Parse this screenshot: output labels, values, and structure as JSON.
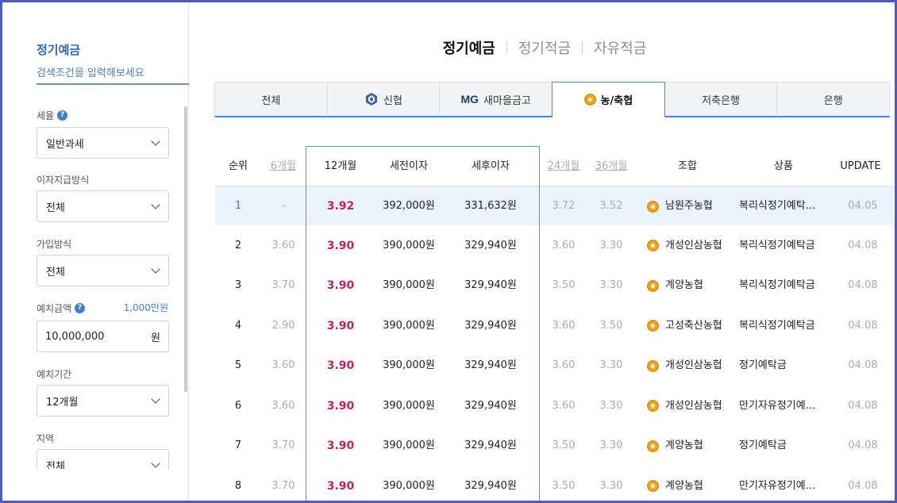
{
  "sidebar": {
    "title": "정기예금",
    "subtitle": "검색조건을 입력해보세요",
    "tax": {
      "label": "세율",
      "value": "일반과세"
    },
    "interest_method": {
      "label": "이자지급방식",
      "value": "전체"
    },
    "join_method": {
      "label": "가입방식",
      "value": "전체"
    },
    "deposit": {
      "label": "예치금액",
      "extra": "1,000만원",
      "value": "10,000,000",
      "unit": "원"
    },
    "period": {
      "label": "예치기간",
      "value": "12개월"
    },
    "region": {
      "label": "지역",
      "value": "전체"
    }
  },
  "main_tabs": [
    "정기예금",
    "정기적금",
    "자유적금"
  ],
  "inst_tabs": [
    {
      "label": "전체",
      "icon": ""
    },
    {
      "label": "신협",
      "icon": "shinhyup-logo-icon"
    },
    {
      "label": "새마을금고",
      "icon": "mg-logo-icon",
      "logo_text": "MG"
    },
    {
      "label": "농/축협",
      "icon": "coin-icon"
    },
    {
      "label": "저축은행",
      "icon": ""
    },
    {
      "label": "은행",
      "icon": ""
    }
  ],
  "table": {
    "headers": {
      "rank": "순위",
      "m6": "6개월",
      "m12": "12개월",
      "pretax": "세전이자",
      "aftertax": "세후이자",
      "m24": "24개월",
      "m36": "36개월",
      "bank": "조합",
      "product": "상품",
      "update": "UPDATE"
    },
    "rows": [
      {
        "rank": "1",
        "m6": "-",
        "m12": "3.92",
        "pretax": "392,000원",
        "aftertax": "331,632원",
        "m24": "3.72",
        "m36": "3.52",
        "bank": "남원주농협",
        "product": "복리식정기예탁…",
        "update": "04.05"
      },
      {
        "rank": "2",
        "m6": "3.60",
        "m12": "3.90",
        "pretax": "390,000원",
        "aftertax": "329,940원",
        "m24": "3.60",
        "m36": "3.30",
        "bank": "개성인삼농협",
        "product": "복리식정기예탁금",
        "update": "04.08"
      },
      {
        "rank": "3",
        "m6": "3.70",
        "m12": "3.90",
        "pretax": "390,000원",
        "aftertax": "329,940원",
        "m24": "3.50",
        "m36": "3.30",
        "bank": "계양농협",
        "product": "복리식정기예탁금",
        "update": "04.08"
      },
      {
        "rank": "4",
        "m6": "2.90",
        "m12": "3.90",
        "pretax": "390,000원",
        "aftertax": "329,940원",
        "m24": "3.60",
        "m36": "3.50",
        "bank": "고성축산농협",
        "product": "복리식정기예탁금",
        "update": "04.08"
      },
      {
        "rank": "5",
        "m6": "3.60",
        "m12": "3.90",
        "pretax": "390,000원",
        "aftertax": "329,940원",
        "m24": "3.60",
        "m36": "3.30",
        "bank": "개성인삼농협",
        "product": "정기예탁금",
        "update": "04.08"
      },
      {
        "rank": "6",
        "m6": "3.60",
        "m12": "3.90",
        "pretax": "390,000원",
        "aftertax": "329,940원",
        "m24": "3.60",
        "m36": "3.30",
        "bank": "개성인삼농협",
        "product": "만기자유정기예…",
        "update": "04.08"
      },
      {
        "rank": "7",
        "m6": "3.70",
        "m12": "3.90",
        "pretax": "390,000원",
        "aftertax": "329,940원",
        "m24": "3.50",
        "m36": "3.30",
        "bank": "계양농협",
        "product": "정기예탁금",
        "update": "04.08"
      },
      {
        "rank": "8",
        "m6": "3.70",
        "m12": "3.90",
        "pretax": "390,000원",
        "aftertax": "329,940원",
        "m24": "3.50",
        "m36": "3.30",
        "bank": "계양농협",
        "product": "만기자유정기예…",
        "update": "04.08"
      }
    ]
  }
}
